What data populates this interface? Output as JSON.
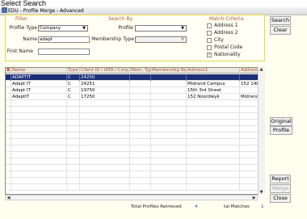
{
  "caption": "Select Search",
  "window": {
    "title": "EDU - Profile Merge - Advanced"
  },
  "filter": {
    "header": "Filter",
    "profile_type_label": "Profile Type",
    "profile_type_value": "Company",
    "name_label": "Name",
    "name_value": "adapt",
    "first_name_label": "First Name",
    "first_name_value": ""
  },
  "search_by": {
    "header": "Search By",
    "profile_label": "Profile",
    "profile_value": "",
    "membership_type_label": "Membership Type",
    "membership_type_value": ""
  },
  "match_criteria": {
    "header": "Match Criteria",
    "items": [
      {
        "label": "Address 1",
        "checked": false
      },
      {
        "label": "Address 2",
        "checked": false
      },
      {
        "label": "City",
        "checked": false
      },
      {
        "label": "Postal Code",
        "checked": false
      },
      {
        "label": "Nationality",
        "checked": true
      }
    ]
  },
  "buttons": {
    "search": "Search",
    "clear": "Clear",
    "original": "Original",
    "profile": "Profile",
    "report": "Report",
    "merge": "Merge",
    "close": "Close"
  },
  "grid": {
    "columns": [
      "X",
      "Name",
      "Type",
      "Client ID / IATA / Corp",
      "Mem. Type",
      "Membership No",
      "Address1",
      "Address2"
    ],
    "rows": [
      {
        "x": "",
        "name": "ADAPTIT",
        "type": "C",
        "client_id": "24250",
        "mem_type": "",
        "membership_no": "",
        "address1": "",
        "address2": ""
      },
      {
        "x": "",
        "name": "Adapt IT",
        "type": "C",
        "client_id": "24251",
        "mem_type": "",
        "membership_no": "",
        "address1": "Midrand Campus",
        "address2": "152 14th"
      },
      {
        "x": "",
        "name": "Adapt IT",
        "type": "C",
        "client_id": "19750",
        "mem_type": "",
        "membership_no": "",
        "address1": "15th 3rd Street",
        "address2": ""
      },
      {
        "x": "",
        "name": "AdaptIT",
        "type": "C",
        "client_id": "17250",
        "mem_type": "",
        "membership_no": "",
        "address1": "152 Noordwyk",
        "address2": "Midrand"
      }
    ]
  },
  "status": {
    "total_profiles_label": "Total Profiles Retrieved",
    "total_profiles_value": "4",
    "total_matches_label": "tal Matches",
    "total_matches_value": "1"
  }
}
